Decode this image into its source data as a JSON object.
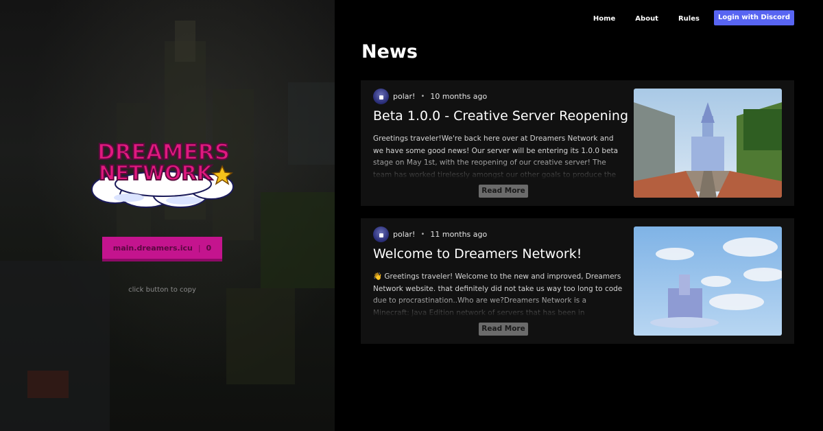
{
  "nav": {
    "items": [
      "Home",
      "About",
      "Rules"
    ],
    "login_label": "Login with Discord"
  },
  "hero": {
    "logo_line1": "DREAMERS",
    "logo_line2": "NETWORK",
    "server_ip": "main.dreamers.icu",
    "player_count": "0",
    "copy_hint": "click button to copy"
  },
  "news": {
    "heading": "News",
    "read_more_label": "Read More",
    "posts": [
      {
        "author": "polar!",
        "time": "10 months ago",
        "title": "Beta 1.0.0 - Creative Server Reopening",
        "excerpt": "Greetings traveler!We're back here over at Dreamers Network and we have some good news! Our server will be entering its 1.0.0 beta stage on May 1st, with the reopening of our creative server! The team has worked tirelessly amongst our other goals to produce the most"
      },
      {
        "author": "polar!",
        "time": "11 months ago",
        "title": "Welcome to Dreamers Network!",
        "excerpt": "👋 Greetings traveler! Welcome to the new and improved, Dreamers Network website. that definitely did not take us way too long to code due to procrastination..Who are we?Dreamers Network is a Minecraft: Java Edition network of servers that has been in development for"
      }
    ]
  },
  "colors": {
    "accent_pink": "#c4148e",
    "discord_blue": "#5865f2",
    "card_bg": "#111111"
  }
}
